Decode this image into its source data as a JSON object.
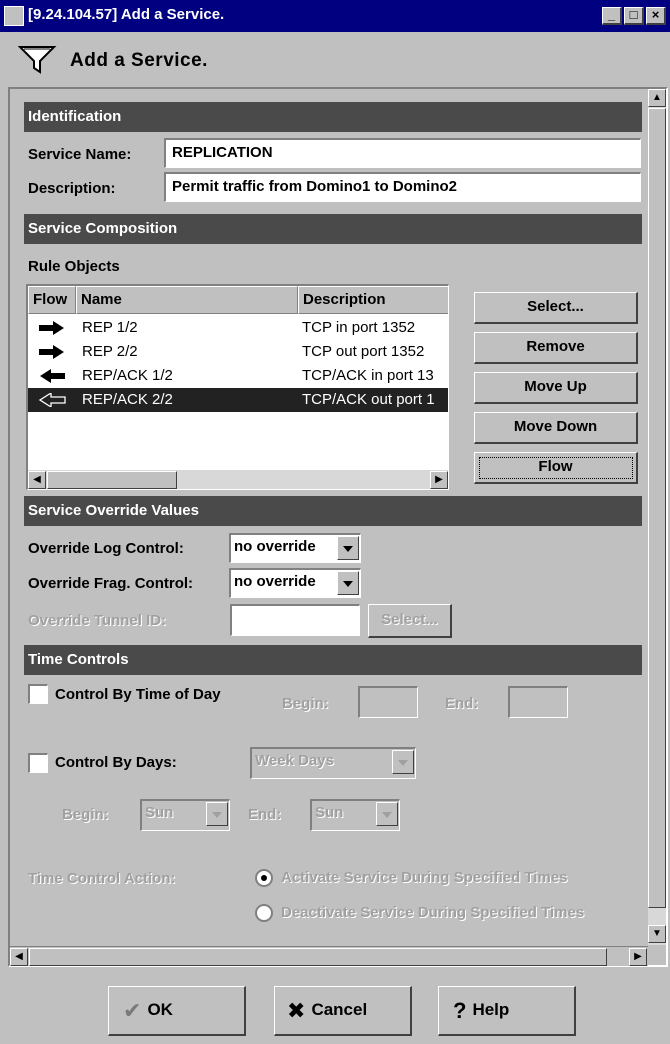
{
  "window": {
    "title": "[9.24.104.57] Add a Service.",
    "minimize_icon": "minimize-icon",
    "maximize_icon": "maximize-icon",
    "close_icon": "close-icon"
  },
  "header": {
    "title": "Add a Service.",
    "icon": "funnel-filter-icon"
  },
  "identification": {
    "section_label": "Identification",
    "service_name_label": "Service Name:",
    "service_name_value": "REPLICATION",
    "description_label": "Description:",
    "description_value": "Permit traffic from Domino1 to Domino2"
  },
  "composition": {
    "section_label": "Service Composition",
    "rule_objects_label": "Rule Objects",
    "columns": [
      "Flow",
      "Name",
      "Description"
    ],
    "rows": [
      {
        "flow_icon": "arrow-right-icon",
        "name": "REP 1/2",
        "description": "TCP in port 1352"
      },
      {
        "flow_icon": "arrow-right-icon",
        "name": "REP 2/2",
        "description": "TCP out port 1352"
      },
      {
        "flow_icon": "arrow-left-icon",
        "name": "REP/ACK 1/2",
        "description": "TCP/ACK in port 13"
      },
      {
        "flow_icon": "arrow-left-outline-icon",
        "name": "REP/ACK 2/2",
        "description": "TCP/ACK out port 1"
      }
    ],
    "buttons": {
      "select": "Select...",
      "remove": "Remove",
      "move_up": "Move Up",
      "move_down": "Move Down",
      "flow": "Flow"
    }
  },
  "override": {
    "section_label": "Service Override Values",
    "log_label": "Override Log Control:",
    "log_value": "no override",
    "frag_label": "Override Frag. Control:",
    "frag_value": "no override",
    "tunnel_label": "Override Tunnel ID:",
    "tunnel_value": "",
    "tunnel_select": "Select..."
  },
  "time": {
    "section_label": "Time Controls",
    "time_of_day_label": "Control By Time of Day",
    "begin_label": "Begin:",
    "end_label": "End:",
    "days_label": "Control By Days:",
    "days_value": "Week Days",
    "days_begin_label": "Begin:",
    "days_begin_value": "Sun",
    "days_end_label": "End:",
    "days_end_value": "Sun",
    "action_label": "Time Control Action:",
    "activate_label": "Activate Service During Specified Times",
    "deactivate_label": "Deactivate Service During Specified Times"
  },
  "footer": {
    "ok": "OK",
    "cancel": "Cancel",
    "help": "Help",
    "ok_icon": "checkmark-icon",
    "cancel_icon": "x-icon",
    "help_icon": "question-mark-icon"
  }
}
